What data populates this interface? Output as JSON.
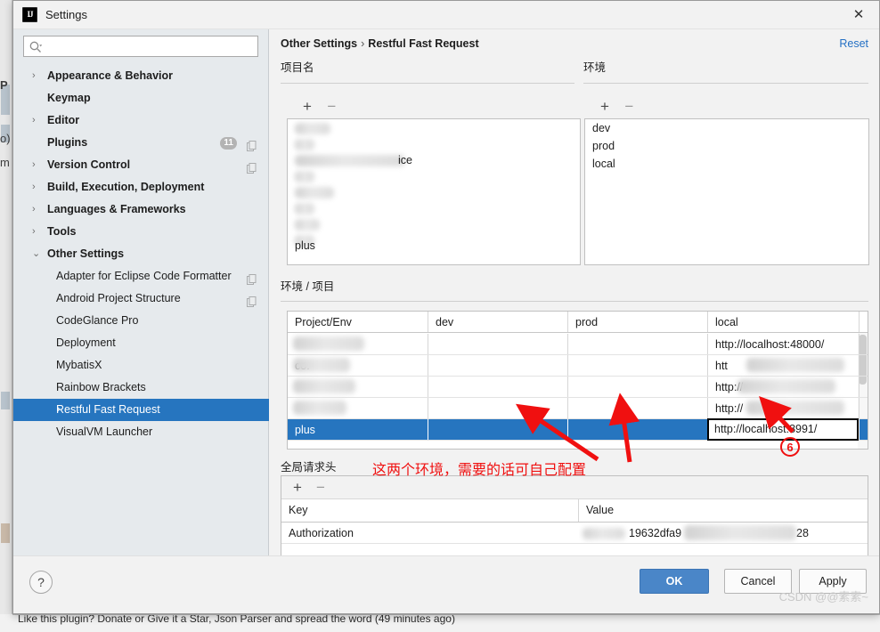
{
  "window": {
    "title": "Settings",
    "app_icon": "intellij-idea-icon",
    "close_icon": "close-icon"
  },
  "sidebar": {
    "search": {
      "placeholder": "",
      "value": "",
      "icon": "search-icon"
    },
    "items": [
      {
        "label": "Appearance & Behavior",
        "level": 1,
        "arrow": "›",
        "selected": false
      },
      {
        "label": "Keymap",
        "level": 1,
        "arrow": "",
        "selected": false
      },
      {
        "label": "Editor",
        "level": 1,
        "arrow": "›",
        "selected": false
      },
      {
        "label": "Plugins",
        "level": 1,
        "arrow": "",
        "selected": false,
        "badge": "11",
        "copy": true
      },
      {
        "label": "Version Control",
        "level": 1,
        "arrow": "›",
        "selected": false,
        "copy": true
      },
      {
        "label": "Build, Execution, Deployment",
        "level": 1,
        "arrow": "›",
        "selected": false
      },
      {
        "label": "Languages & Frameworks",
        "level": 1,
        "arrow": "›",
        "selected": false
      },
      {
        "label": "Tools",
        "level": 1,
        "arrow": "›",
        "selected": false
      },
      {
        "label": "Other Settings",
        "level": 1,
        "arrow": "⌄",
        "selected": false
      },
      {
        "label": "Adapter for Eclipse Code Formatter",
        "level": 2,
        "arrow": "",
        "selected": false,
        "copy": true
      },
      {
        "label": "Android Project Structure",
        "level": 2,
        "arrow": "",
        "selected": false,
        "copy": true
      },
      {
        "label": "CodeGlance Pro",
        "level": 2,
        "arrow": "",
        "selected": false
      },
      {
        "label": "Deployment",
        "level": 2,
        "arrow": "",
        "selected": false
      },
      {
        "label": "MybatisX",
        "level": 2,
        "arrow": "",
        "selected": false
      },
      {
        "label": "Rainbow Brackets",
        "level": 2,
        "arrow": "",
        "selected": false
      },
      {
        "label": "Restful Fast Request",
        "level": 2,
        "arrow": "›",
        "selected": true
      },
      {
        "label": "VisualVM Launcher",
        "level": 2,
        "arrow": "",
        "selected": false
      }
    ]
  },
  "content": {
    "breadcrumb": {
      "parent": "Other Settings",
      "separator": "›",
      "current": "Restful Fast Request"
    },
    "reset_label": "Reset",
    "project_section": {
      "label": "项目名",
      "add_icon": "plus-icon",
      "remove_icon": "minus-icon",
      "items": [
        {
          "text": "",
          "redacted": true
        },
        {
          "text": "ice",
          "redacted": true
        },
        {
          "text": "",
          "redacted": true
        },
        {
          "text": "",
          "redacted": true
        },
        {
          "text": "",
          "redacted": true
        },
        {
          "text": "plus",
          "redacted": false
        }
      ]
    },
    "env_section": {
      "label": "环境",
      "add_icon": "plus-icon",
      "remove_icon": "minus-icon",
      "items": [
        {
          "text": "dev"
        },
        {
          "text": "prod"
        },
        {
          "text": "local"
        }
      ]
    },
    "matrix_section": {
      "label": "环境 / 项目",
      "columns": [
        "Project/Env",
        "dev",
        "prod",
        "local"
      ],
      "rows": [
        {
          "project": "",
          "dev": "",
          "prod": "",
          "local": "http://localhost:48000/",
          "redacted": true,
          "selected": false
        },
        {
          "project": "co.",
          "dev": "",
          "prod": "",
          "local": "htt",
          "redacted": true,
          "selected": false
        },
        {
          "project": "",
          "dev": "",
          "prod": "",
          "local": "http://",
          "redacted": true,
          "selected": false
        },
        {
          "project": "",
          "dev": "",
          "prod": "",
          "local": "http://",
          "redacted": true,
          "selected": false
        },
        {
          "project": "plus",
          "dev": "",
          "prod": "",
          "local": "http://localhost:8991/",
          "redacted": false,
          "selected": true
        }
      ],
      "editing_cell_value": "http://localhost:8991/"
    },
    "headers_section": {
      "label": "全局请求头",
      "add_icon": "plus-icon",
      "remove_icon": "minus-icon",
      "columns": [
        "Key",
        "Value"
      ],
      "rows": [
        {
          "key": "Authorization",
          "value_prefix": "19632dfa9",
          "value_suffix": "28",
          "redacted": true
        }
      ]
    }
  },
  "footer": {
    "help_label": "?",
    "ok_label": "OK",
    "cancel_label": "Cancel",
    "apply_label": "Apply",
    "watermark": "CSDN @@素素~"
  },
  "annotations": {
    "note_text": "这两个环境，需要的话可自己配置",
    "step_number": "6",
    "arrow_color": "#f01010"
  },
  "background": {
    "status_text": "Like this plugin? Donate or Give it a Star, Json Parser and spread the word (49 minutes ago)",
    "ghost_p": "P",
    "ghost_o": "o)",
    "ghost_m": "m"
  }
}
